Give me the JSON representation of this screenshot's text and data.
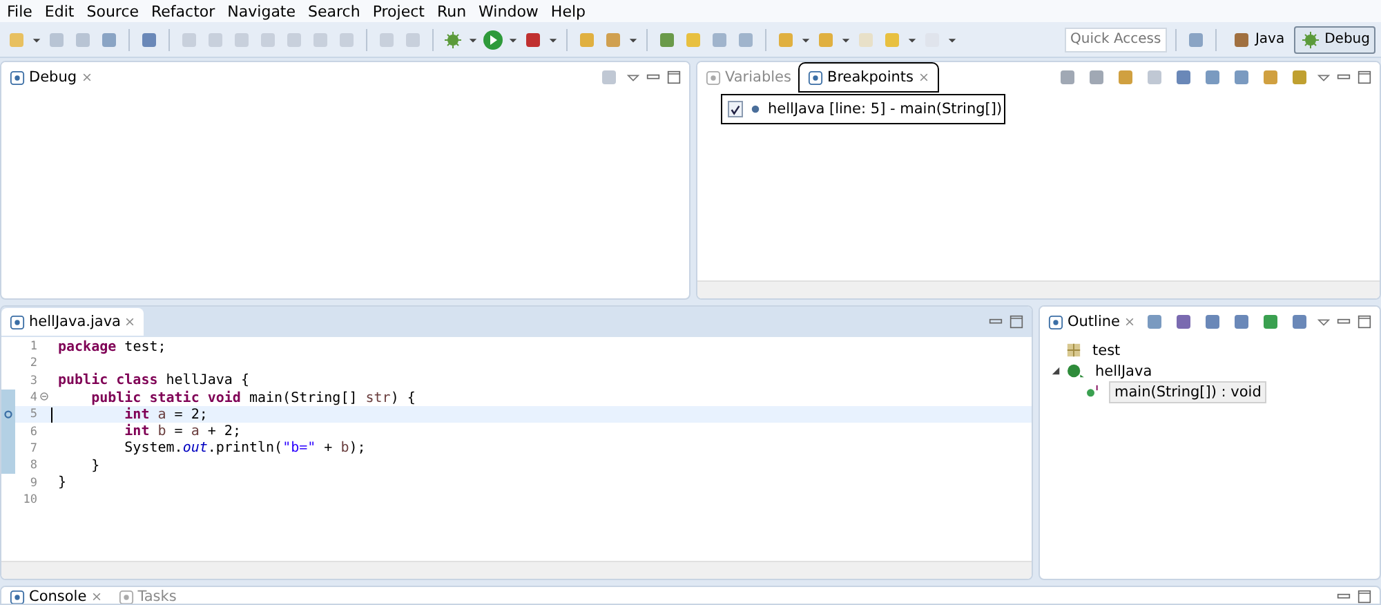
{
  "menu": [
    "File",
    "Edit",
    "Source",
    "Refactor",
    "Navigate",
    "Search",
    "Project",
    "Run",
    "Window",
    "Help"
  ],
  "quick_access": {
    "placeholder": "Quick Access"
  },
  "perspectives": [
    {
      "label": "Java",
      "selected": false
    },
    {
      "label": "Debug",
      "selected": true
    }
  ],
  "debug_view": {
    "tabs": [
      {
        "label": "Debug",
        "selected": true
      }
    ]
  },
  "breakpoints_view": {
    "tabs": [
      {
        "label": "Variables",
        "selected": false,
        "annotated": false
      },
      {
        "label": "Breakpoints",
        "selected": true,
        "annotated": true
      }
    ],
    "items": [
      {
        "label": "hellJava [line: 5] - main(String[])",
        "checked": true,
        "annotated": true
      }
    ]
  },
  "editor": {
    "tabs": [
      {
        "label": "hellJava.java",
        "selected": true
      }
    ],
    "lines": [
      {
        "number": "1",
        "tokens": [
          {
            "kind": "keyword",
            "text": "package"
          },
          {
            "kind": "plain",
            "text": " test;"
          }
        ]
      },
      {
        "number": "2"
      },
      {
        "number": "3",
        "tokens": [
          {
            "kind": "keyword",
            "text": "public class"
          },
          {
            "kind": "plain",
            "text": " hellJava {"
          }
        ]
      },
      {
        "number": "4",
        "fold": true,
        "tokens": [
          {
            "kind": "keyword",
            "text": "    public static void"
          },
          {
            "kind": "plain",
            "text": " main(String[] "
          },
          {
            "kind": "param",
            "text": "str"
          },
          {
            "kind": "plain",
            "text": ") {"
          }
        ]
      },
      {
        "number": "5",
        "breakpoint": true,
        "current": true,
        "tokens": [
          {
            "kind": "keyword",
            "text": "        int"
          },
          {
            "kind": "local",
            "text": " a"
          },
          {
            "kind": "plain",
            "text": " = 2;"
          }
        ]
      },
      {
        "number": "6",
        "tokens": [
          {
            "kind": "keyword",
            "text": "        int"
          },
          {
            "kind": "local",
            "text": " b"
          },
          {
            "kind": "plain",
            "text": " = "
          },
          {
            "kind": "local",
            "text": "a"
          },
          {
            "kind": "plain",
            "text": " + 2;"
          }
        ]
      },
      {
        "number": "7",
        "tokens": [
          {
            "kind": "plain",
            "text": "        System."
          },
          {
            "kind": "field",
            "text": "out"
          },
          {
            "kind": "plain",
            "text": ".println("
          },
          {
            "kind": "string",
            "text": "\"b=\""
          },
          {
            "kind": "plain",
            "text": " + "
          },
          {
            "kind": "local",
            "text": "b"
          },
          {
            "kind": "plain",
            "text": ");"
          }
        ]
      },
      {
        "number": "8",
        "tokens": [
          {
            "kind": "plain",
            "text": "    }"
          }
        ]
      },
      {
        "number": "9",
        "tokens": [
          {
            "kind": "plain",
            "text": "}"
          }
        ]
      },
      {
        "number": "10"
      }
    ]
  },
  "outline": {
    "tabs": [
      {
        "label": "Outline",
        "selected": true
      }
    ],
    "tree": [
      {
        "kind": "package",
        "label": "test",
        "selected": false
      },
      {
        "kind": "class",
        "label": "hellJava",
        "expanded": true,
        "selected": false,
        "children": [
          {
            "kind": "method",
            "label": "main(String[]) : void",
            "selected": true
          }
        ]
      }
    ]
  },
  "bottom_view": {
    "tabs": [
      {
        "label": "Console",
        "selected": true
      },
      {
        "label": "Tasks",
        "selected": false
      }
    ]
  }
}
